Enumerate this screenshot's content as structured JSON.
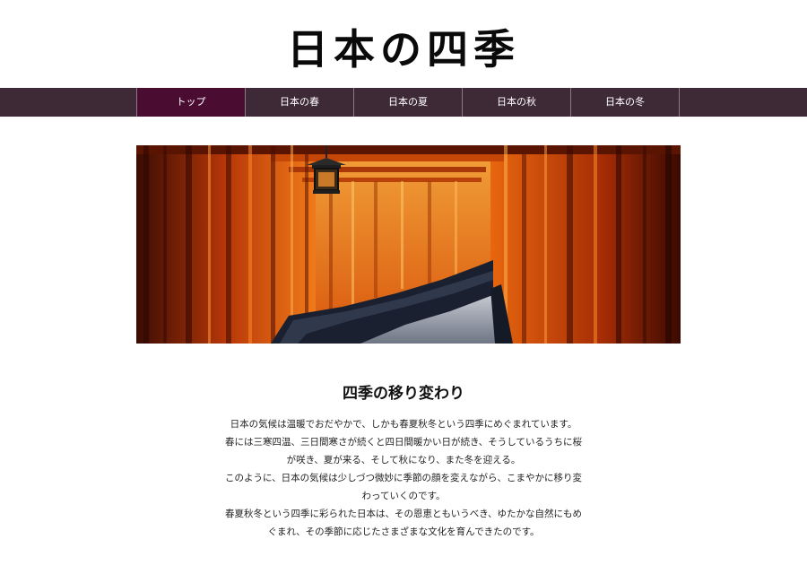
{
  "site": {
    "title": "日本の四季"
  },
  "nav": {
    "items": [
      {
        "label": "トップ",
        "active": true
      },
      {
        "label": "日本の春",
        "active": false
      },
      {
        "label": "日本の夏",
        "active": false
      },
      {
        "label": "日本の秋",
        "active": false
      },
      {
        "label": "日本の冬",
        "active": false
      }
    ]
  },
  "hero": {
    "subject": "torii-gate-tunnel-photo"
  },
  "main": {
    "heading": "四季の移り変わり",
    "paragraphs": [
      "日本の気候は温暖でおだやかで、しかも春夏秋冬という四季にめぐまれています。",
      "春には三寒四温、三日間寒さが続くと四日間暖かい日が続き、そうしているうちに桜が咲き、夏が来る、そして秋になり、また冬を迎える。",
      "このように、日本の気候は少しづつ微妙に季節の顔を変えながら、こまやかに移り変わっていくのです。",
      "春夏秋冬という四季に彩られた日本は、その恩恵ともいうべき、ゆたかな自然にもめぐまれ、その季節に応じたさまざまな文化を育んできたのです。"
    ]
  },
  "colors": {
    "nav_background": "#3e2a36",
    "nav_active": "#4b0c31",
    "torii_orange": "#e0560f"
  }
}
